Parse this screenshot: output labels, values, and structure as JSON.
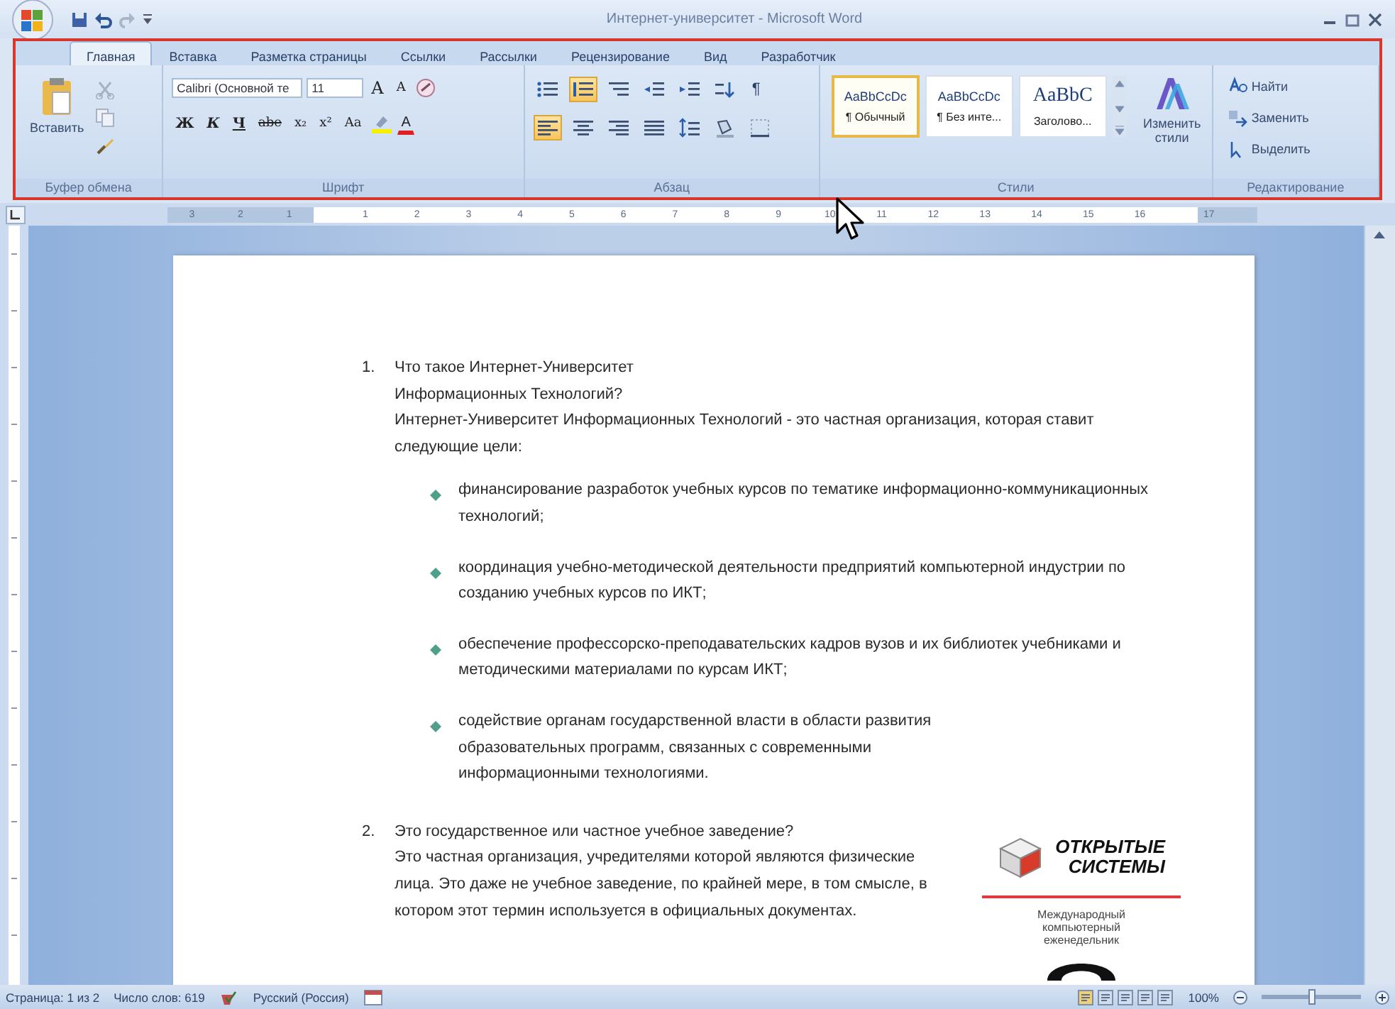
{
  "title_bar": {
    "title": "Интернет-университет - Microsoft Word"
  },
  "ribbon": {
    "tabs": [
      {
        "label": "Главная",
        "selected": true
      },
      {
        "label": "Вставка",
        "selected": false
      },
      {
        "label": "Разметка страницы",
        "selected": false
      },
      {
        "label": "Ссылки",
        "selected": false
      },
      {
        "label": "Рассылки",
        "selected": false
      },
      {
        "label": "Рецензирование",
        "selected": false
      },
      {
        "label": "Вид",
        "selected": false
      },
      {
        "label": "Разработчик",
        "selected": false
      }
    ],
    "clipboard": {
      "paste": "Вставить",
      "label": "Буфер обмена"
    },
    "font": {
      "name": "Calibri (Основной те",
      "size": "11",
      "grow": "A",
      "shrink": "A",
      "format_buttons": [
        {
          "label": "Ж",
          "kind": "bold"
        },
        {
          "label": "К",
          "kind": "italic"
        },
        {
          "label": "Ч",
          "kind": "underline"
        },
        {
          "label": "abe",
          "kind": "strike"
        },
        {
          "label": "x₂",
          "kind": "subscript"
        },
        {
          "label": "x²",
          "kind": "superscript"
        },
        {
          "label": "Aa",
          "kind": "case"
        }
      ],
      "font_color": "A",
      "label": "Шрифт"
    },
    "paragraph": {
      "rows": [
        [
          {
            "kind": "bullets",
            "on": false
          },
          {
            "kind": "numbering",
            "on": true
          },
          {
            "kind": "multilevel",
            "on": false
          },
          {
            "kind": "outdent",
            "on": false
          },
          {
            "kind": "indent",
            "on": false
          },
          {
            "kind": "sort",
            "on": false
          },
          {
            "kind": "pilcrow",
            "label": "¶",
            "on": false
          }
        ],
        [
          {
            "kind": "align-left",
            "on": true
          },
          {
            "kind": "center",
            "on": false
          },
          {
            "kind": "align-right",
            "on": false
          },
          {
            "kind": "justify",
            "on": false
          },
          {
            "kind": "line-spacing",
            "on": false
          },
          {
            "kind": "shading",
            "on": false
          },
          {
            "kind": "borders",
            "on": false
          }
        ]
      ],
      "label": "Абзац"
    },
    "styles": {
      "items": [
        {
          "sample": "AaBbCcDc",
          "name": "¶ Обычный",
          "selected": true,
          "kind": "body"
        },
        {
          "sample": "AaBbCcDc",
          "name": "¶ Без инте...",
          "selected": false,
          "kind": "body"
        },
        {
          "sample": "AaBbC",
          "name": "Заголово...",
          "selected": false,
          "kind": "heading"
        }
      ],
      "change_styles": "Изменить стили",
      "label": "Стили"
    },
    "editing": {
      "items": [
        {
          "label": "Найти",
          "kind": "find"
        },
        {
          "label": "Заменить",
          "kind": "replace"
        },
        {
          "label": "Выделить",
          "kind": "select"
        }
      ],
      "label": "Редактирование"
    }
  },
  "ruler": {
    "left_numbers": [
      "3",
      "2",
      "1"
    ],
    "numbers": [
      "1",
      "2",
      "3",
      "4",
      "5",
      "6",
      "7",
      "8",
      "9",
      "10",
      "11",
      "12",
      "13",
      "14",
      "15",
      "16"
    ],
    "right_numbers": [
      "17"
    ]
  },
  "document": {
    "items": [
      {
        "number": "1.",
        "title": "Что такое Интернет-Университет Информационных Технологий?",
        "text": "Интернет-Университет Информационных Технологий - это частная организация, которая ставит следующие цели:",
        "bullets": [
          "финансирование разработок учебных курсов по тематике информационно-коммуникационных технологий;",
          "координация учебно-методической деятельности предприятий компьютерной индустрии по созданию учебных курсов по ИКТ;",
          "обеспечение профессорско-преподавательских кадров вузов и их библиотек учебниками и методическими материалами по курсам ИКТ;",
          "содействие органам государственной власти в области развития образовательных программ, связанных с современными информационными технологиями."
        ]
      },
      {
        "number": "2.",
        "title": "Это государственное или частное учебное заведение?",
        "text": "Это частная организация, учредителями которой являются физические лица. Это даже не учебное заведение, по крайней мере, в том смысле, в котором этот термин используется в официальных документах."
      }
    ],
    "logo": {
      "name": "ОТКРЫТЫЕ СИСТЕМЫ",
      "tagline": "Международный компьютерный еженедельник"
    }
  },
  "status_bar": {
    "page": "Страница: 1 из 2",
    "words": "Число слов: 619",
    "language": "Русский (Россия)",
    "zoom": "100%",
    "zoom_slider": {
      "level": 0.5
    }
  }
}
